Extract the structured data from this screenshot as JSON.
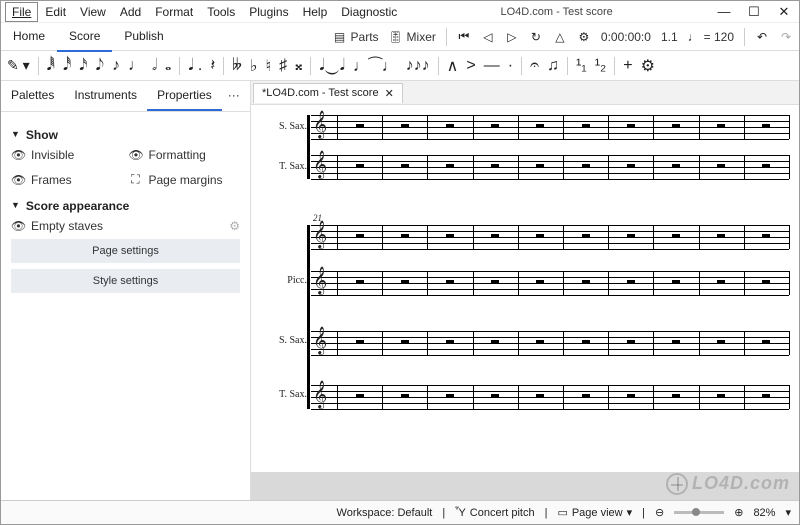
{
  "title": "LO4D.com - Test score",
  "menu": {
    "file": "File",
    "edit": "Edit",
    "view": "View",
    "add": "Add",
    "format": "Format",
    "tools": "Tools",
    "plugins": "Plugins",
    "help": "Help",
    "diagnostic": "Diagnostic"
  },
  "main_tabs": {
    "home": "Home",
    "score": "Score",
    "publish": "Publish",
    "active": "Score"
  },
  "top_controls": {
    "parts": "Parts",
    "mixer": "Mixer",
    "time": "0:00:00:0",
    "pos": "1.1",
    "tempo_note": "♩",
    "tempo_eq": "= 120"
  },
  "note_toolbar": {
    "durations": [
      "𝅘𝅥𝅱",
      "𝅘𝅥𝅰",
      "𝅘𝅥𝅯",
      "𝅘𝅥𝅮",
      "♪",
      "♩",
      "𝅗𝅥",
      "𝅝"
    ],
    "dot": ".",
    "rest_glyph": "𝄽",
    "accidentals": [
      "𝄫",
      "♭",
      "♮",
      "♯",
      "𝄪"
    ],
    "tie": "𝅘𝅥‿𝅘𝅥",
    "slur": "⁀",
    "triplet": "³",
    "artic": [
      "∧",
      ">",
      "—",
      "·"
    ],
    "flip": "⇵",
    "repeat": "⟲",
    "voice1": "¹₁",
    "voice2": "¹₂",
    "plus": "+",
    "gear": "⚙"
  },
  "sidebar": {
    "tabs": {
      "palettes": "Palettes",
      "instruments": "Instruments",
      "properties": "Properties",
      "more": "···",
      "active": "Properties"
    },
    "show": {
      "header": "Show",
      "invisible": "Invisible",
      "formatting": "Formatting",
      "frames": "Frames",
      "margins": "Page margins"
    },
    "appearance": {
      "header": "Score appearance",
      "empty": "Empty staves",
      "page_settings": "Page settings",
      "style_settings": "Style settings"
    }
  },
  "doc_tab": {
    "name": "*LO4D.com - Test score"
  },
  "staves_top": [
    "S. Sax.",
    "T. Sax."
  ],
  "staves_bottom": [
    "",
    "Picc.",
    "S. Sax.",
    "T. Sax."
  ],
  "measure_number": "21",
  "status": {
    "workspace": "Workspace: Default",
    "concert": "Concert pitch",
    "pageview": "Page view",
    "zoom": "82%"
  },
  "watermark": "LO4D.com"
}
